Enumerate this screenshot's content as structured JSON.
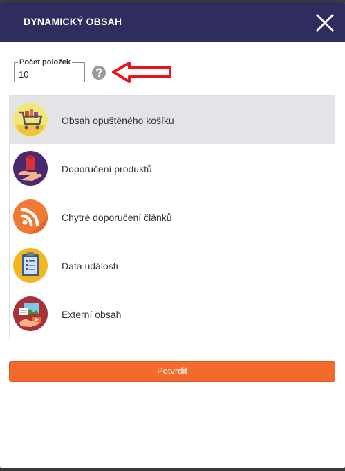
{
  "dialog": {
    "title": "DYNAMICKÝ OBSAH",
    "close_icon": "close-icon"
  },
  "count": {
    "label": "Počet položek",
    "value": "10",
    "help_icon": "question-circle-icon"
  },
  "content_types": [
    {
      "label": "Obsah opuštěného košíku",
      "icon": "shopping-cart-icon",
      "selected": true
    },
    {
      "label": "Doporučení produktů",
      "icon": "product-hand-icon",
      "selected": false
    },
    {
      "label": "Chytré doporučení článků",
      "icon": "rss-icon",
      "selected": false
    },
    {
      "label": "Data události",
      "icon": "clipboard-checklist-icon",
      "selected": false
    },
    {
      "label": "Externí obsah",
      "icon": "external-media-icon",
      "selected": false
    }
  ],
  "confirm_label": "Potvrdit",
  "colors": {
    "header": "#2f2d5e",
    "accent": "#f36a2c",
    "selected_row": "#e4e4e8",
    "annotation_arrow": "#e8151b"
  }
}
